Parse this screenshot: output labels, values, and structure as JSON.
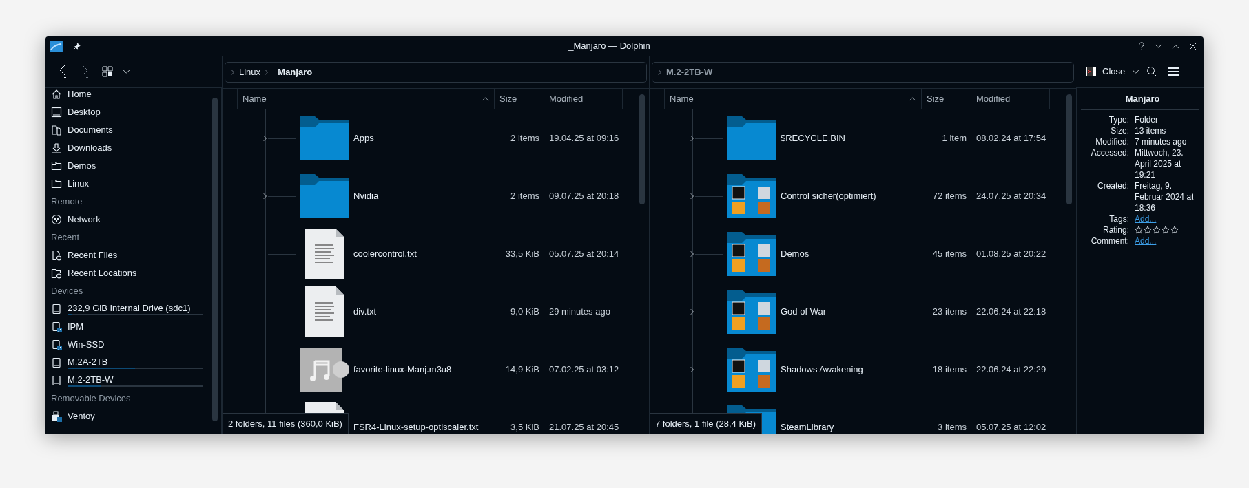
{
  "window": {
    "title": "_Manjaro — Dolphin"
  },
  "toolbar": {
    "close_label": "Close"
  },
  "sidebar": {
    "sections": [
      {
        "items": [
          {
            "label": "Home",
            "kind": "home"
          },
          {
            "label": "Desktop",
            "kind": "desktop"
          },
          {
            "label": "Documents",
            "kind": "documents"
          },
          {
            "label": "Downloads",
            "kind": "downloads"
          },
          {
            "label": "Demos",
            "kind": "folder"
          },
          {
            "label": "Linux",
            "kind": "folder"
          }
        ]
      },
      {
        "heading": "Remote",
        "items": [
          {
            "label": "Network",
            "kind": "network"
          }
        ]
      },
      {
        "heading": "Recent",
        "items": [
          {
            "label": "Recent Files",
            "kind": "recent-files"
          },
          {
            "label": "Recent Locations",
            "kind": "recent-locations"
          }
        ]
      },
      {
        "heading": "Devices",
        "items": [
          {
            "label": "232,9 GiB Internal Drive (sdc1)",
            "kind": "drive",
            "level": 0.03
          },
          {
            "label": "IPM",
            "kind": "drive-link"
          },
          {
            "label": "Win-SSD",
            "kind": "drive-link"
          },
          {
            "label": "M.2A-2TB",
            "kind": "drive",
            "level": 0.5
          },
          {
            "label": "M.2-2TB-W",
            "kind": "drive",
            "level": 0.25
          }
        ]
      },
      {
        "heading": "Removable Devices",
        "items": [
          {
            "label": "Ventoy",
            "kind": "usb"
          }
        ]
      }
    ]
  },
  "panes": [
    {
      "active": true,
      "breadcrumb": [
        {
          "label": "Linux",
          "current": false
        },
        {
          "label": "_Manjaro",
          "current": true
        }
      ],
      "columns": [
        "Name",
        "Size",
        "Modified"
      ],
      "rows": [
        {
          "name": "Apps",
          "size": "2 items",
          "modified": "19.04.25 at 09:16",
          "kind": "folder",
          "expandable": true
        },
        {
          "name": "Nvidia",
          "size": "2 items",
          "modified": "09.07.25 at 20:18",
          "kind": "folder",
          "expandable": true
        },
        {
          "name": "coolercontrol.txt",
          "size": "33,5 KiB",
          "modified": "05.07.25 at 20:14",
          "kind": "text",
          "expandable": false
        },
        {
          "name": "div.txt",
          "size": "9,0 KiB",
          "modified": "29 minutes ago",
          "kind": "text",
          "expandable": false
        },
        {
          "name": "favorite-linux-Manj.m3u8",
          "size": "14,9 KiB",
          "modified": "07.02.25 at 03:12",
          "kind": "playlist",
          "expandable": false
        },
        {
          "name": "FSR4-Linux-setup-optiscaler.txt",
          "size": "3,5 KiB",
          "modified": "21.07.25 at 20:45",
          "kind": "text",
          "expandable": false
        }
      ],
      "status": "2 folders, 11 files (360,0 KiB)"
    },
    {
      "active": false,
      "breadcrumb": [
        {
          "label": "M.2-2TB-W",
          "current": true
        }
      ],
      "columns": [
        "Name",
        "Size",
        "Modified"
      ],
      "rows": [
        {
          "name": "$RECYCLE.BIN",
          "size": "1 item",
          "modified": "08.02.24 at 17:54",
          "kind": "folder",
          "expandable": true
        },
        {
          "name": "Control sicher(optimiert)",
          "size": "72 items",
          "modified": "24.07.25 at 20:34",
          "kind": "folder-preview",
          "expandable": true
        },
        {
          "name": "Demos",
          "size": "45 items",
          "modified": "01.08.25 at 20:22",
          "kind": "folder-preview",
          "expandable": true
        },
        {
          "name": "God of War",
          "size": "23 items",
          "modified": "22.06.24 at 22:18",
          "kind": "folder-preview",
          "expandable": true
        },
        {
          "name": "Shadows Awakening",
          "size": "18 items",
          "modified": "22.06.24 at 22:29",
          "kind": "folder-preview",
          "expandable": true
        },
        {
          "name": "SteamLibrary",
          "size": "3 items",
          "modified": "05.07.25 at 12:02",
          "kind": "folder"
        }
      ],
      "status": "7 folders, 1 file (28,4 KiB)"
    }
  ],
  "info_panel": {
    "title": "_Manjaro",
    "fields": [
      {
        "label": "Type:",
        "kind": "text",
        "value": "Folder"
      },
      {
        "label": "Size:",
        "kind": "text",
        "value": "13 items"
      },
      {
        "label": "Modified:",
        "kind": "text",
        "value": "7 minutes ago"
      },
      {
        "label": "Accessed:",
        "kind": "text",
        "value": "Mittwoch, 23. April 2025 at 19:21"
      },
      {
        "label": "Created:",
        "kind": "text",
        "value": "Freitag, 9. Februar 2024 at 18:36"
      },
      {
        "label": "Tags:",
        "kind": "link",
        "value": "Add..."
      },
      {
        "label": "Rating:",
        "kind": "rating",
        "stars": 0
      },
      {
        "label": "Comment:",
        "kind": "link",
        "value": "Add..."
      }
    ]
  }
}
